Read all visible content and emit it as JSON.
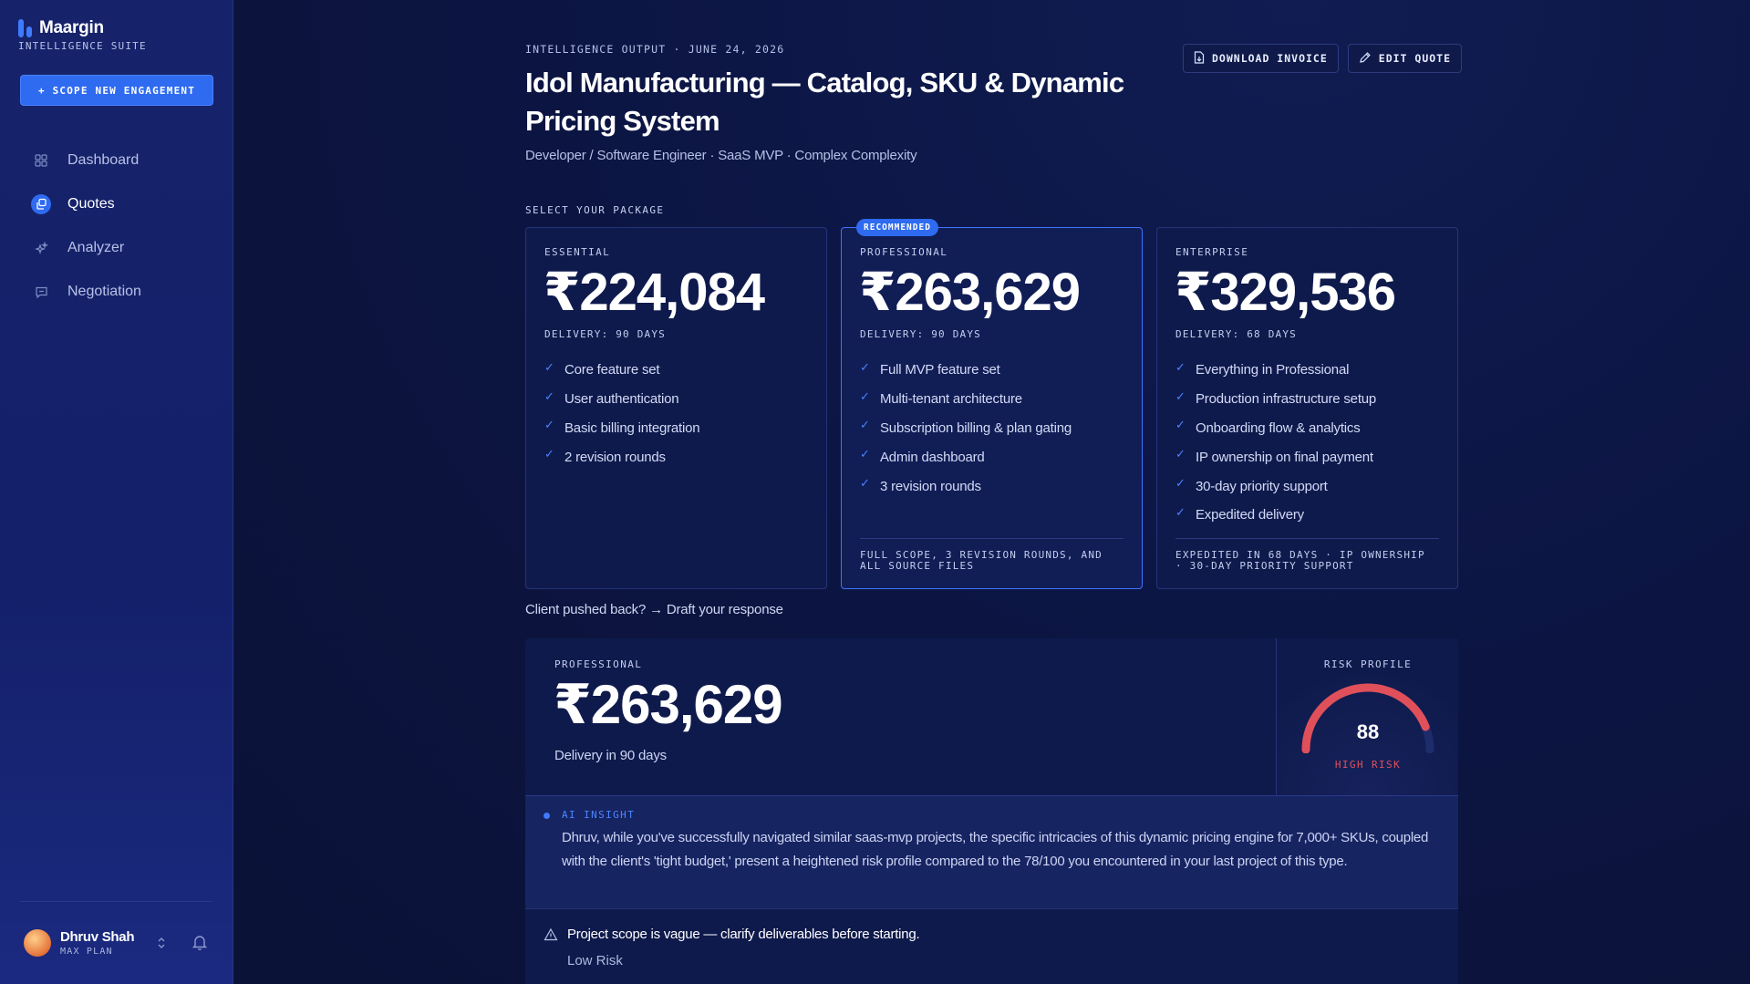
{
  "app": {
    "name": "Maargin",
    "subtitle": "INTELLIGENCE SUITE",
    "accent": "#2f6bf0"
  },
  "sidebar": {
    "cta_label": "+ SCOPE NEW ENGAGEMENT",
    "items": [
      {
        "label": "Dashboard",
        "icon": "grid-icon",
        "active": false
      },
      {
        "label": "Quotes",
        "icon": "quotes-icon",
        "active": true
      },
      {
        "label": "Analyzer",
        "icon": "sparkle-icon",
        "active": false
      },
      {
        "label": "Negotiation",
        "icon": "chat-icon",
        "active": false
      }
    ],
    "user": {
      "name": "Dhruv Shah",
      "plan": "MAX PLAN"
    }
  },
  "header": {
    "meta": "INTELLIGENCE OUTPUT · JUNE 24, 2026",
    "title": "Idol Manufacturing — Catalog, SKU & Dynamic Pricing System",
    "subtitle": "Developer / Software Engineer · SaaS MVP · Complex Complexity",
    "download_label": "DOWNLOAD INVOICE",
    "edit_label": "EDIT QUOTE"
  },
  "packages": {
    "section_label": "SELECT YOUR PACKAGE",
    "recommended_label": "RECOMMENDED",
    "items": [
      {
        "tier": "ESSENTIAL",
        "price": "₹224,084",
        "delivery": "DELIVERY: 90 DAYS",
        "features": [
          "Core feature set",
          "User authentication",
          "Basic billing integration",
          "2 revision rounds"
        ],
        "footer": ""
      },
      {
        "tier": "PROFESSIONAL",
        "price": "₹263,629",
        "delivery": "DELIVERY: 90 DAYS",
        "features": [
          "Full MVP feature set",
          "Multi-tenant architecture",
          "Subscription billing & plan gating",
          "Admin dashboard",
          "3 revision rounds"
        ],
        "footer": "FULL SCOPE, 3 REVISION ROUNDS, AND ALL SOURCE FILES"
      },
      {
        "tier": "ENTERPRISE",
        "price": "₹329,536",
        "delivery": "DELIVERY: 68 DAYS",
        "features": [
          "Everything in Professional",
          "Production infrastructure setup",
          "Onboarding flow & analytics",
          "IP ownership on final payment",
          "30-day priority support",
          "Expedited delivery"
        ],
        "footer": "EXPEDITED IN 68 DAYS · IP OWNERSHIP · 30-DAY PRIORITY SUPPORT"
      }
    ]
  },
  "pushback_link": "Client pushed back? → Draft your response",
  "summary": {
    "tier": "PROFESSIONAL",
    "price": "₹263,629",
    "delivery": "Delivery in 90 days",
    "risk_label": "RISK PROFILE",
    "risk_score": "88",
    "risk_score_value": 88,
    "risk_level": "HIGH RISK",
    "risk_color": "#e0505a"
  },
  "insight": {
    "label": "AI INSIGHT",
    "text": "Dhruv, while you've successfully navigated similar saas-mvp projects, the specific intricacies of this dynamic pricing engine for 7,000+ SKUs, coupled with the client's 'tight budget,' present a heightened risk profile compared to the 78/100 you encountered in your last project of this type."
  },
  "flag": {
    "text": "Project scope is vague — clarify deliverables before starting.",
    "level": "Low Risk"
  }
}
